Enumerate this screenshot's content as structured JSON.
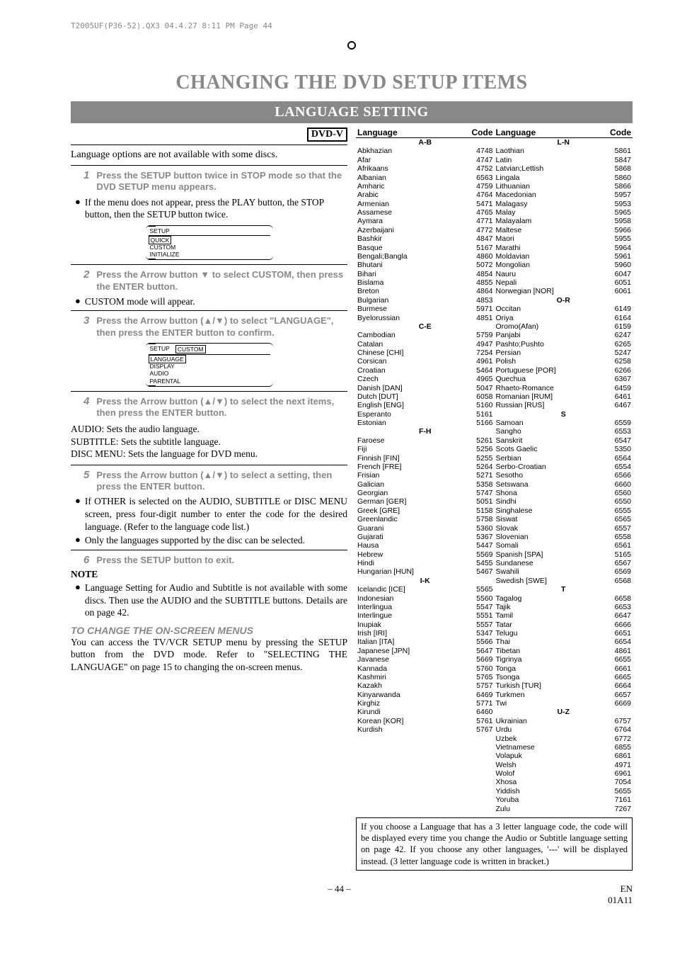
{
  "header_line": "T2005UF(P36-52).QX3  04.4.27  8:11 PM  Page 44",
  "main_title": "CHANGING THE DVD SETUP ITEMS",
  "sub_title": "LANGUAGE SETTING",
  "dvd_v": "DVD-V",
  "intro": "Language options are not available with some discs.",
  "step1_num": "1",
  "step1": "Press the SETUP button twice in STOP mode so that the DVD SETUP menu appears.",
  "bullet_if_menu": "If the menu does not appear, press the PLAY button, the STOP button, then the SETUP button twice.",
  "menu1": {
    "top": "SETUP",
    "items": [
      "QUICK",
      "CUSTOM",
      "INITIALIZE"
    ]
  },
  "step2_num": "2",
  "step2": "Press the Arrow button ▼ to select CUSTOM, then press the ENTER button.",
  "bullet_custom_mode": "CUSTOM mode will appear.",
  "step3_num": "3",
  "step3": "Press the Arrow button (▲/▼) to select \"LANGUAGE\", then press the ENTER button to confirm.",
  "menu2": {
    "top_left": "SETUP",
    "top_right": "CUSTOM",
    "items": [
      "LANGUAGE",
      "DISPLAY",
      "AUDIO",
      "PARENTAL"
    ]
  },
  "step4_num": "4",
  "step4": "Press the Arrow button (▲/▼) to select the next items, then press the ENTER button.",
  "audio_line": "AUDIO: Sets the audio language.",
  "subtitle_line": "SUBTITLE: Sets the subtitle language.",
  "discmenu_line": "DISC MENU: Sets the language for DVD menu.",
  "step5_num": "5",
  "step5": "Press the Arrow button (▲/▼) to select a setting, then press the ENTER button.",
  "bullet_if_other": "If OTHER is selected on the AUDIO, SUBTITLE or DISC MENU screen, press four-digit number to enter the code for the desired language. (Refer to the language code list.)",
  "bullet_only_lang": "Only the languages supported by the disc can be selected.",
  "step6_num": "6",
  "step6": "Press the SETUP button to exit.",
  "note_head": "NOTE",
  "note_bullet": "Language Setting for Audio and Subtitle is not available with some discs. Then use the AUDIO and the SUBTITLE buttons. Details are on page 42.",
  "change_menus_head": "TO CHANGE THE ON-SCREEN MENUS",
  "change_menus_body": "You can access the TV/VCR SETUP menu by pressing the SETUP button from the DVD mode. Refer to \"SELECTING THE LANGUAGE\" on page 15 to changing the on-screen menus.",
  "lang_label": "Language",
  "code_label": "Code",
  "groups_left": [
    {
      "h": "A-B",
      "rows": [
        [
          "Abkhazian",
          "4748"
        ],
        [
          "Afar",
          "4747"
        ],
        [
          "Afrikaans",
          "4752"
        ],
        [
          "Albanian",
          "6563"
        ],
        [
          "Amharic",
          "4759"
        ],
        [
          "Arabic",
          "4764"
        ],
        [
          "Armenian",
          "5471"
        ],
        [
          "Assamese",
          "4765"
        ],
        [
          "Aymara",
          "4771"
        ],
        [
          "Azerbaijani",
          "4772"
        ],
        [
          "Bashkir",
          "4847"
        ],
        [
          "Basque",
          "5167"
        ],
        [
          "Bengali;Bangla",
          "4860"
        ],
        [
          "Bhutani",
          "5072"
        ],
        [
          "Bihari",
          "4854"
        ],
        [
          "Bislama",
          "4855"
        ],
        [
          "Breton",
          "4864"
        ],
        [
          "Bulgarian",
          "4853"
        ],
        [
          "Burmese",
          "5971"
        ],
        [
          "Byelorussian",
          "4851"
        ]
      ]
    },
    {
      "h": "C-E",
      "rows": [
        [
          "Cambodian",
          "5759"
        ],
        [
          "Catalan",
          "4947"
        ],
        [
          "Chinese [CHI]",
          "7254"
        ],
        [
          "Corsican",
          "4961"
        ],
        [
          "Croatian",
          "5464"
        ],
        [
          "Czech",
          "4965"
        ],
        [
          "Danish [DAN]",
          "5047"
        ],
        [
          "Dutch [DUT]",
          "6058"
        ],
        [
          "English [ENG]",
          "5160"
        ],
        [
          "Esperanto",
          "5161"
        ],
        [
          "Estonian",
          "5166"
        ]
      ]
    },
    {
      "h": "F-H",
      "rows": [
        [
          "Faroese",
          "5261"
        ],
        [
          "Fiji",
          "5256"
        ],
        [
          "Finnish [FIN]",
          "5255"
        ],
        [
          "French [FRE]",
          "5264"
        ],
        [
          "Frisian",
          "5271"
        ],
        [
          "Galician",
          "5358"
        ],
        [
          "Georgian",
          "5747"
        ],
        [
          "German [GER]",
          "5051"
        ],
        [
          "Greek [GRE]",
          "5158"
        ],
        [
          "Greenlandic",
          "5758"
        ],
        [
          "Guarani",
          "5360"
        ],
        [
          "Gujarati",
          "5367"
        ],
        [
          "Hausa",
          "5447"
        ],
        [
          "Hebrew",
          "5569"
        ],
        [
          "Hindi",
          "5455"
        ],
        [
          "Hungarian [HUN]",
          "5467"
        ]
      ]
    },
    {
      "h": "I-K",
      "rows": [
        [
          "Icelandic [ICE]",
          "5565"
        ],
        [
          "Indonesian",
          "5560"
        ],
        [
          "Interlingua",
          "5547"
        ],
        [
          "Interlingue",
          "5551"
        ],
        [
          "Inupiak",
          "5557"
        ],
        [
          "Irish [IRI]",
          "5347"
        ],
        [
          "Italian [ITA]",
          "5566"
        ],
        [
          "Japanese [JPN]",
          "5647"
        ],
        [
          "Javanese",
          "5669"
        ],
        [
          "Kannada",
          "5760"
        ],
        [
          "Kashmiri",
          "5765"
        ],
        [
          "Kazakh",
          "5757"
        ],
        [
          "Kinyarwanda",
          "6469"
        ],
        [
          "Kirghiz",
          "5771"
        ],
        [
          "Kirundi",
          "6460"
        ],
        [
          "Korean [KOR]",
          "5761"
        ],
        [
          "Kurdish",
          "5767"
        ]
      ]
    }
  ],
  "groups_right": [
    {
      "h": "L-N",
      "rows": [
        [
          "Laothian",
          "5861"
        ],
        [
          "Latin",
          "5847"
        ],
        [
          "Latvian;Lettish",
          "5868"
        ],
        [
          "Lingala",
          "5860"
        ],
        [
          "Lithuanian",
          "5866"
        ],
        [
          "Macedonian",
          "5957"
        ],
        [
          "Malagasy",
          "5953"
        ],
        [
          "Malay",
          "5965"
        ],
        [
          "Malayalam",
          "5958"
        ],
        [
          "Maltese",
          "5966"
        ],
        [
          "Maori",
          "5955"
        ],
        [
          "Marathi",
          "5964"
        ],
        [
          "Moldavian",
          "5961"
        ],
        [
          "Mongolian",
          "5960"
        ],
        [
          "Nauru",
          "6047"
        ],
        [
          "Nepali",
          "6051"
        ],
        [
          "Norwegian [NOR]",
          "6061"
        ]
      ]
    },
    {
      "h": "O-R",
      "rows": [
        [
          "Occitan",
          "6149"
        ],
        [
          "Oriya",
          "6164"
        ],
        [
          "Oromo(Afan)",
          "6159"
        ],
        [
          "Panjabi",
          "6247"
        ],
        [
          "Pashto;Pushto",
          "6265"
        ],
        [
          "Persian",
          "5247"
        ],
        [
          "Polish",
          "6258"
        ],
        [
          "Portuguese [POR]",
          "6266"
        ],
        [
          "Quechua",
          "6367"
        ],
        [
          "Rhaeto-Romance",
          "6459"
        ],
        [
          "Romanian [RUM]",
          "6461"
        ],
        [
          "Russian [RUS]",
          "6467"
        ]
      ]
    },
    {
      "h": "S",
      "rows": [
        [
          "Samoan",
          "6559"
        ],
        [
          "Sangho",
          "6553"
        ],
        [
          "Sanskrit",
          "6547"
        ],
        [
          "Scots Gaelic",
          "5350"
        ],
        [
          "Serbian",
          "6564"
        ],
        [
          "Serbo-Croatian",
          "6554"
        ],
        [
          "Sesotho",
          "6566"
        ],
        [
          "Setswana",
          "6660"
        ],
        [
          "Shona",
          "6560"
        ],
        [
          "Sindhi",
          "6550"
        ],
        [
          "Singhalese",
          "6555"
        ],
        [
          "Siswat",
          "6565"
        ],
        [
          "Slovak",
          "6557"
        ],
        [
          "Slovenian",
          "6558"
        ],
        [
          "Somali",
          "6561"
        ],
        [
          "Spanish [SPA]",
          "5165"
        ],
        [
          "Sundanese",
          "6567"
        ],
        [
          "Swahili",
          "6569"
        ],
        [
          "Swedish [SWE]",
          "6568"
        ]
      ]
    },
    {
      "h": "T",
      "rows": [
        [
          "Tagalog",
          "6658"
        ],
        [
          "Tajik",
          "6653"
        ],
        [
          "Tamil",
          "6647"
        ],
        [
          "Tatar",
          "6666"
        ],
        [
          "Telugu",
          "6651"
        ],
        [
          "Thai",
          "6654"
        ],
        [
          "Tibetan",
          "4861"
        ],
        [
          "Tigrinya",
          "6655"
        ],
        [
          "Tonga",
          "6661"
        ],
        [
          "Tsonga",
          "6665"
        ],
        [
          "Turkish [TUR]",
          "6664"
        ],
        [
          "Turkmen",
          "6657"
        ],
        [
          "Twi",
          "6669"
        ]
      ]
    },
    {
      "h": "U-Z",
      "rows": [
        [
          "Ukrainian",
          "6757"
        ],
        [
          "Urdu",
          "6764"
        ],
        [
          "Uzbek",
          "6772"
        ],
        [
          "Vietnamese",
          "6855"
        ],
        [
          "Volapuk",
          "6861"
        ],
        [
          "Welsh",
          "4971"
        ],
        [
          "Wolof",
          "6961"
        ],
        [
          "Xhosa",
          "7054"
        ],
        [
          "Yiddish",
          "5655"
        ],
        [
          "Yoruba",
          "7161"
        ],
        [
          "Zulu",
          "7267"
        ]
      ]
    }
  ],
  "info_box": "If you choose a Language that has a 3 letter language code, the code will be displayed every time you change the Audio or Subtitle language setting on page 42. If you choose any other languages, '---' will be displayed instead. (3 letter language code is written in bracket.)",
  "page_num": "– 44 –",
  "footer_right1": "EN",
  "footer_right2": "01A11"
}
